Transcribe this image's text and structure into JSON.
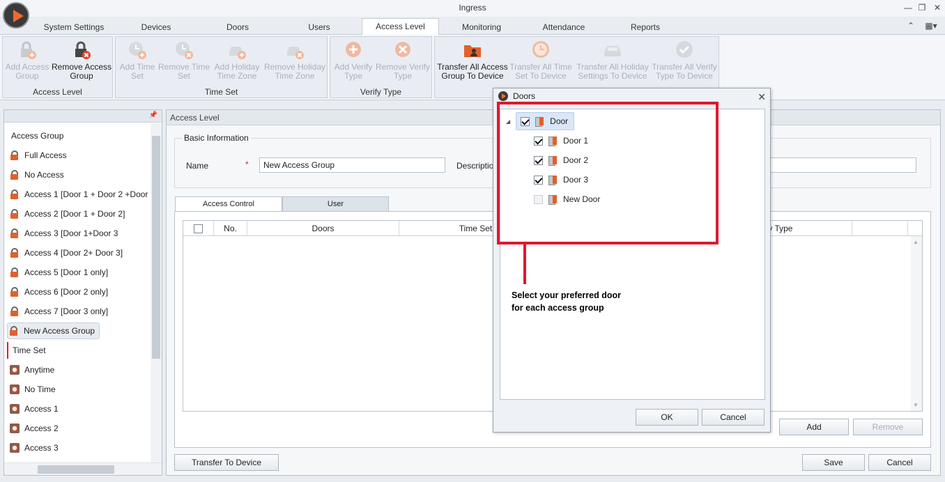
{
  "window": {
    "title": "Ingress"
  },
  "tabs": [
    "System Settings",
    "Devices",
    "Doors",
    "Users",
    "Access Level",
    "Monitoring",
    "Attendance",
    "Reports"
  ],
  "ribbon": {
    "access_level": {
      "label": "Access Level",
      "add": "Add Access\nGroup",
      "remove": "Remove Access\nGroup"
    },
    "time_set": {
      "label": "Time Set",
      "add_time": "Add Time\nSet",
      "remove_time": "Remove Time\nSet",
      "add_holiday": "Add Holiday\nTime Zone",
      "remove_holiday": "Remove Holiday\nTime Zone"
    },
    "verify_type": {
      "label": "Verify Type",
      "add": "Add Verify\nType",
      "remove": "Remove Verify\nType"
    },
    "transfer": {
      "group": "Transfer All Access\nGroup To Device",
      "time": "Transfer All Time\nSet To Device",
      "holiday": "Transfer All Holiday\nSettings To Device",
      "verify": "Transfer All Verify\nType To Device"
    }
  },
  "sidebar": {
    "access_group_header": "Access Group",
    "groups": [
      "Full Access",
      "No Access",
      "Access 1 [Door 1 + Door 2 +Door",
      "Access 2 [Door 1 + Door 2]",
      "Access 3 [Door 1+Door 3",
      "Access 4 [Door 2+ Door 3]",
      "Access 5 [Door 1 only]",
      "Access 6 [Door 2 only]",
      "Access 7 [Door 3 only]",
      "New Access Group"
    ],
    "time_set_header": "Time Set",
    "time_sets": [
      "Anytime",
      "No Time",
      "Access 1",
      "Access 2",
      "Access 3"
    ]
  },
  "main": {
    "header": "Access Level",
    "basic_info": "Basic Information",
    "name_label": "Name",
    "required": "*",
    "name_value": "New Access Group",
    "description_label": "Descriptio",
    "subtabs": [
      "Access Control",
      "User"
    ],
    "columns": [
      "No.",
      "Doors",
      "Time Set",
      "fy Type"
    ],
    "add": "Add",
    "remove": "Remove",
    "transfer": "Transfer To Device",
    "save": "Save",
    "cancel": "Cancel"
  },
  "dialog": {
    "title": "Doors",
    "root": "Door",
    "doors": [
      {
        "name": "Door 1",
        "checked": true
      },
      {
        "name": "Door 2",
        "checked": true
      },
      {
        "name": "Door 3",
        "checked": true
      },
      {
        "name": "New Door",
        "checked": false
      }
    ],
    "ok": "OK",
    "cancel": "Cancel"
  },
  "annotation": {
    "line1": "Select your preferred door",
    "line2": "for each access group"
  },
  "colors": {
    "accent": "#ef6a2b",
    "annotation": "#e0182d"
  }
}
